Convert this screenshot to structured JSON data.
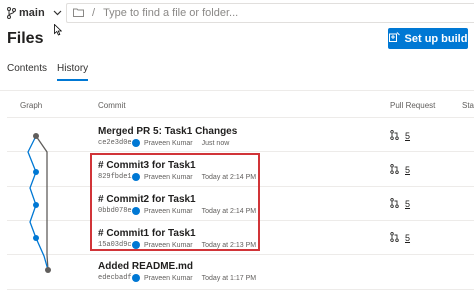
{
  "branch": {
    "name": "main"
  },
  "path": {
    "separator": "/",
    "placeholder": "Type to find a file or folder..."
  },
  "page": {
    "title": "Files"
  },
  "setup_button": {
    "label": "Set up build"
  },
  "tabs": [
    {
      "label": "Contents",
      "active": false
    },
    {
      "label": "History",
      "active": true
    }
  ],
  "columns": {
    "graph": "Graph",
    "commit": "Commit",
    "pull_request": "Pull Request",
    "status": "Sta"
  },
  "commits": [
    {
      "message": "Merged PR 5: Task1 Changes",
      "hash": "ce2e3d0e",
      "author": "Praveen Kumar",
      "time": "Just now",
      "pr": "5"
    },
    {
      "message": "# Commit3 for Task1",
      "hash": "829fbde1",
      "author": "Praveen Kumar",
      "time": "Today at 2:14 PM",
      "pr": "5"
    },
    {
      "message": "# Commit2 for Task1",
      "hash": "0bbd078e",
      "author": "Praveen Kumar",
      "time": "Today at 2:14 PM",
      "pr": "5"
    },
    {
      "message": "# Commit1 for Task1",
      "hash": "15a03d9c",
      "author": "Praveen Kumar",
      "time": "Today at 2:13 PM",
      "pr": "5"
    },
    {
      "message": "Added README.md",
      "hash": "edecbadf",
      "author": "Praveen Kumar",
      "time": "Today at 1:17 PM",
      "pr": ""
    }
  ],
  "colors": {
    "accent": "#0078d4",
    "highlight": "#d13438",
    "graph_main": "#605e5c"
  },
  "icons": {
    "branch": "branch-icon",
    "folder": "folder-icon",
    "build": "build-icon",
    "pull_request": "pull-request-icon"
  }
}
